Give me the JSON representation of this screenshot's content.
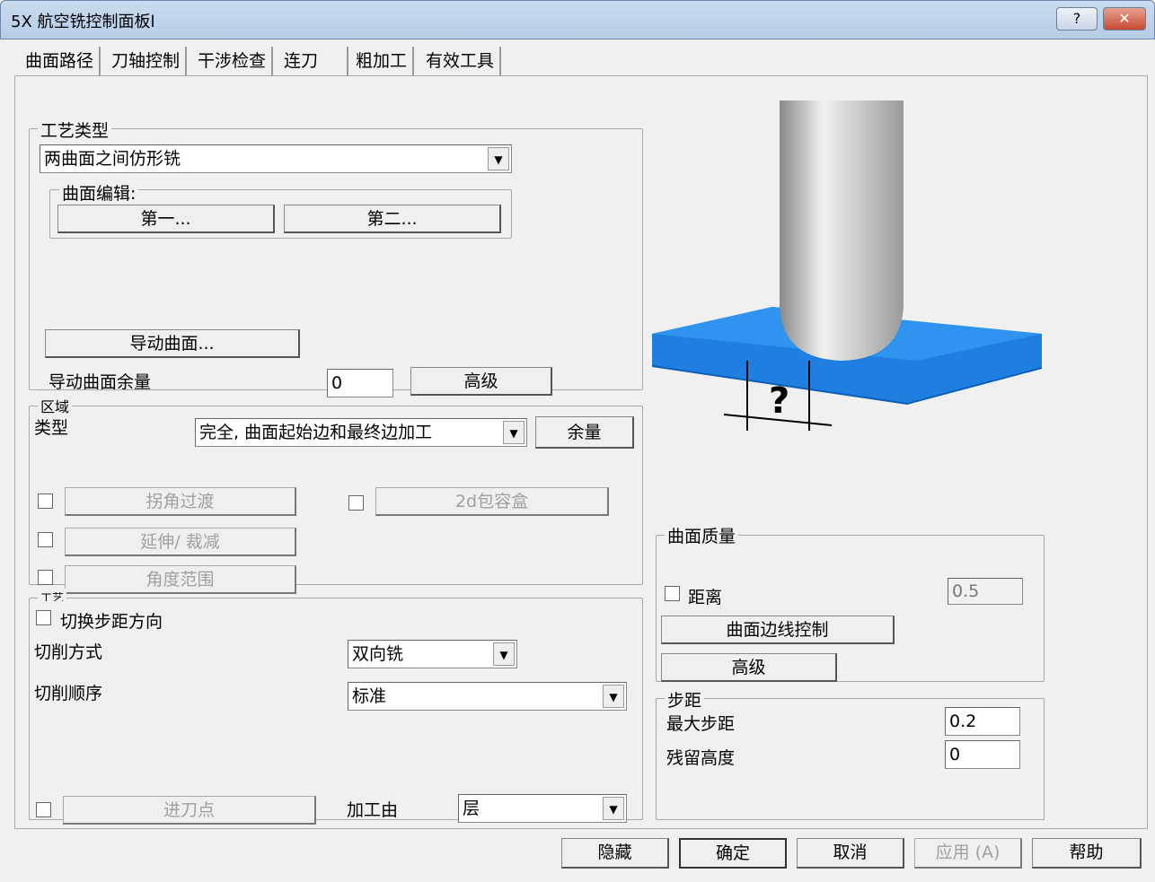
{
  "window": {
    "title": "5X 航空铣控制面板l",
    "help": "?",
    "close": "✕"
  },
  "tabs": [
    "曲面路径",
    "刀轴控制",
    "干涉检查",
    "连刀",
    "粗加工",
    "有效工具"
  ],
  "process": {
    "label": "工艺类型",
    "type": "两曲面之间仿形铣",
    "surface_edit_label": "曲面编辑:",
    "first": "第一...",
    "second": "第二...",
    "guide_surface": "导动曲面...",
    "guide_allowance_label": "导动曲面余量",
    "guide_allowance": "0",
    "advanced": "高级"
  },
  "region": {
    "label": "区域",
    "type_label": "类型",
    "type": "完全, 曲面起始边和最终边加工",
    "allowance": "余量",
    "corner": "拐角过渡",
    "bbox": "2d包容盒",
    "extend": "延伸/ 裁减",
    "angle": "角度范围"
  },
  "pattern": {
    "label": "工艺",
    "switch_step": "切换步距方向",
    "cut_method_label": "切削方式",
    "cut_method": "双向铣",
    "cut_order_label": "切削顺序",
    "cut_order": "标准",
    "entry": "进刀点",
    "machine_by_label": "加工由",
    "machine_by": "层"
  },
  "quality": {
    "label": "曲面质量",
    "distance": "距离",
    "distance_value": "0.5",
    "edge_control": "曲面边线控制",
    "advanced": "高级"
  },
  "stepover": {
    "label": "步距",
    "max_label": "最大步距",
    "max": "0.2",
    "scallop_label": "残留高度",
    "scallop": "0"
  },
  "illustration": {
    "question": "?"
  },
  "footer": {
    "hide": "隐藏",
    "ok": "确定",
    "cancel": "取消",
    "apply": "应用 (A)",
    "help": "帮助"
  }
}
